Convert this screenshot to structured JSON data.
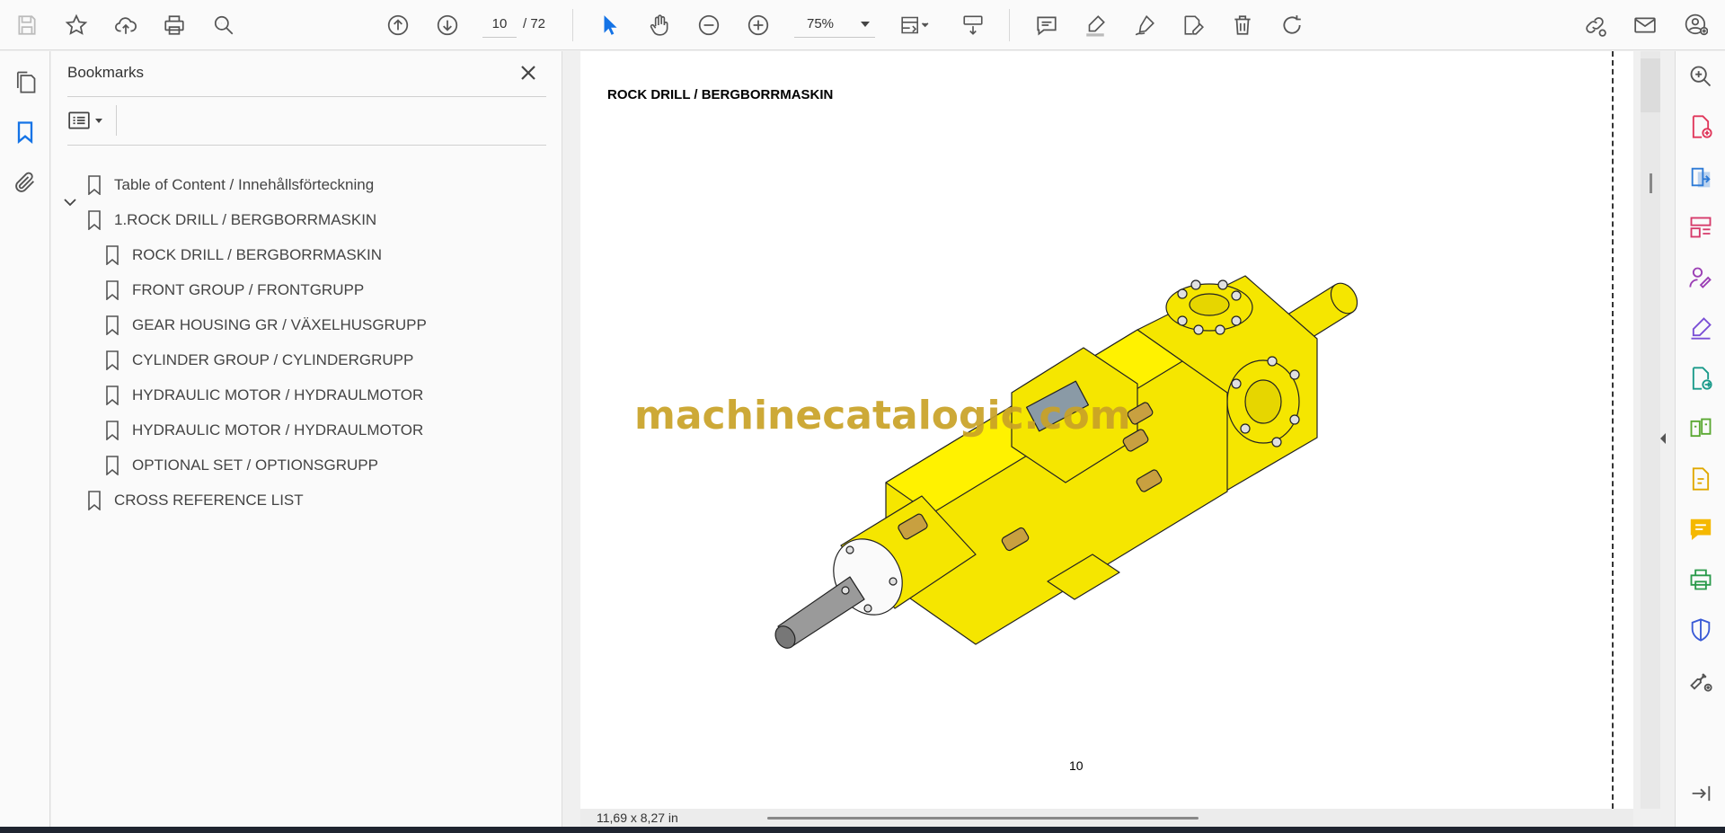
{
  "toolbar": {
    "page_current": "10",
    "page_total": "/  72",
    "zoom": "75%"
  },
  "bookmarks": {
    "title": "Bookmarks",
    "items": [
      {
        "label": "Table of Content / Innehållsförteckning",
        "level": 0,
        "expanded": false
      },
      {
        "label": "1.ROCK DRILL / BERGBORRMASKIN",
        "level": 0,
        "expanded": true
      },
      {
        "label": "ROCK DRILL / BERGBORRMASKIN",
        "level": 1
      },
      {
        "label": "FRONT GROUP / FRONTGRUPP",
        "level": 1
      },
      {
        "label": "GEAR HOUSING GR / VÄXELHUSGRUPP",
        "level": 1
      },
      {
        "label": "CYLINDER GROUP / CYLINDERGRUPP",
        "level": 1
      },
      {
        "label": "HYDRAULIC MOTOR / HYDRAULMOTOR",
        "level": 1
      },
      {
        "label": "HYDRAULIC MOTOR / HYDRAULMOTOR",
        "level": 1
      },
      {
        "label": "OPTIONAL SET / OPTIONSGRUPP",
        "level": 1
      },
      {
        "label": "CROSS REFERENCE LIST",
        "level": 0
      }
    ]
  },
  "document": {
    "heading": "ROCK DRILL / BERGBORRMASKIN",
    "watermark": "machinecatalogic.com",
    "page_number": "10",
    "page_size": "11,69 x 8,27 in"
  },
  "colors": {
    "accent_blue": "#1473e6",
    "drill_yellow": "#f5e600",
    "watermark": "#c9a227"
  }
}
